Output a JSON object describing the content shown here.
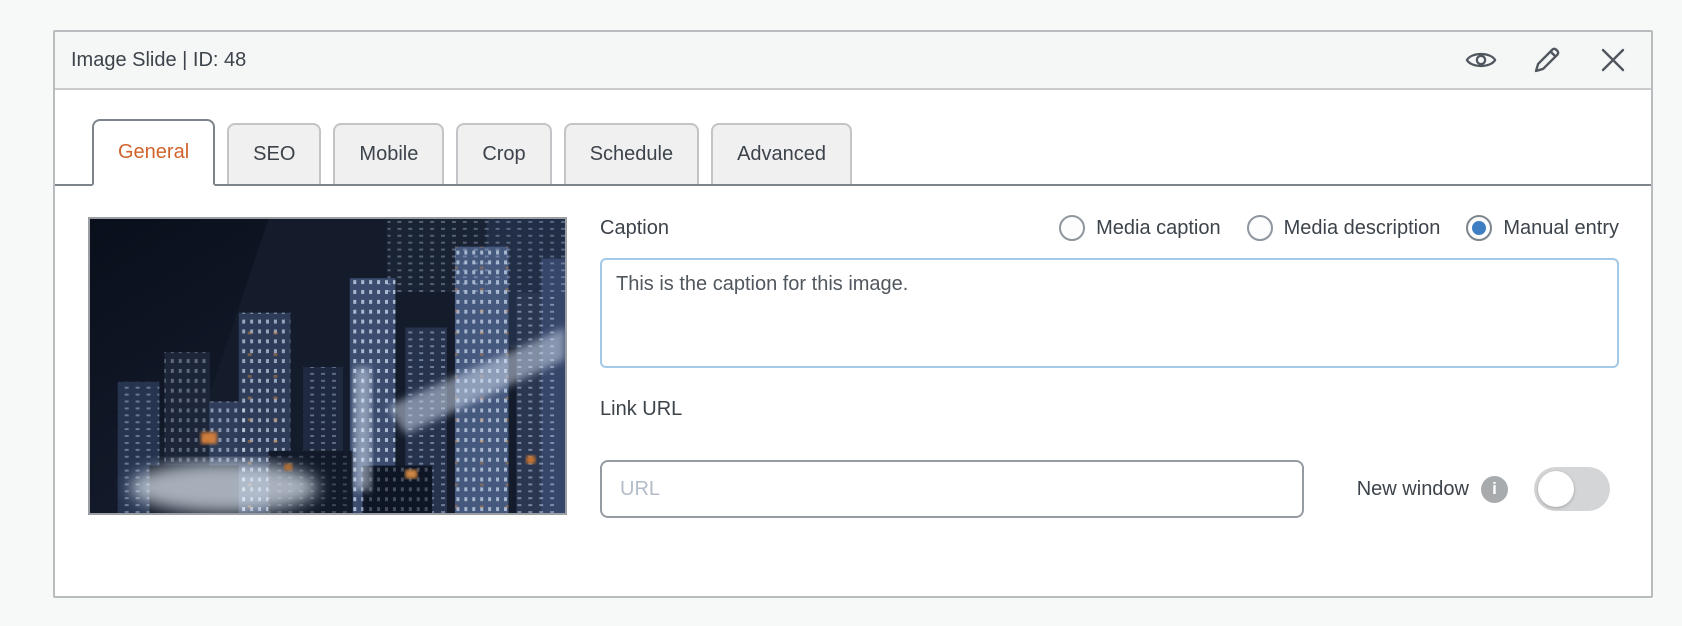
{
  "window": {
    "title": "Image Slide | ID: 48",
    "icons": [
      {
        "name": "preview-eye-icon"
      },
      {
        "name": "edit-pencil-icon"
      },
      {
        "name": "close-icon"
      }
    ]
  },
  "tabs": [
    {
      "label": "General",
      "active": true
    },
    {
      "label": "SEO",
      "active": false
    },
    {
      "label": "Mobile",
      "active": false
    },
    {
      "label": "Crop",
      "active": false
    },
    {
      "label": "Schedule",
      "active": false
    },
    {
      "label": "Advanced",
      "active": false
    }
  ],
  "general": {
    "caption": {
      "label": "Caption",
      "options": [
        {
          "label": "Media caption",
          "selected": false
        },
        {
          "label": "Media description",
          "selected": false
        },
        {
          "label": "Manual entry",
          "selected": true
        }
      ],
      "text": "This is the caption for this image."
    },
    "link": {
      "label": "Link URL",
      "value": "",
      "placeholder": "URL",
      "new_window": {
        "label": "New window",
        "enabled": false,
        "info_glyph": "i"
      }
    }
  },
  "colors": {
    "accent_orange": "#d0642c",
    "radio_blue": "#3d7fc2",
    "textarea_border": "#a3c9e8"
  }
}
